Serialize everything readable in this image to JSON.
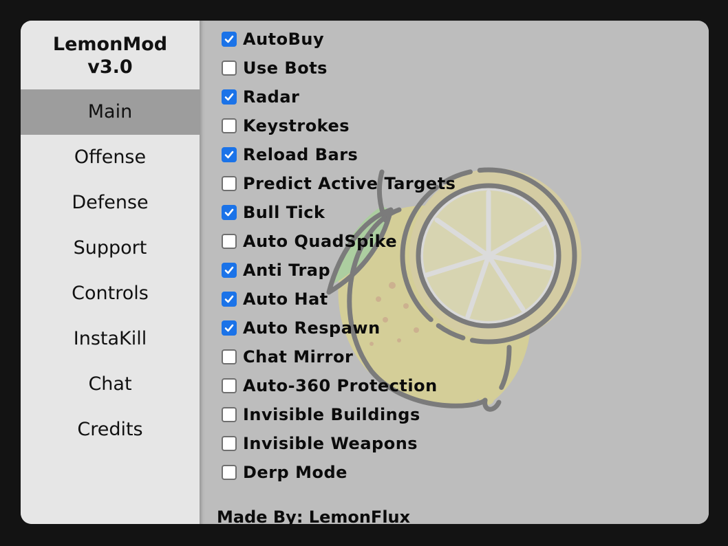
{
  "app": {
    "title": "LemonMod v3.0"
  },
  "sidebar": {
    "title_line1": "LemonMod",
    "title_line2": "v3.0",
    "active": "Main",
    "items": [
      {
        "label": "Main"
      },
      {
        "label": "Offense"
      },
      {
        "label": "Defense"
      },
      {
        "label": "Support"
      },
      {
        "label": "Controls"
      },
      {
        "label": "InstaKill"
      },
      {
        "label": "Chat"
      },
      {
        "label": "Credits"
      }
    ]
  },
  "main": {
    "options": [
      {
        "label": "AutoBuy",
        "checked": true
      },
      {
        "label": "Use Bots",
        "checked": false
      },
      {
        "label": "Radar",
        "checked": true
      },
      {
        "label": "Keystrokes",
        "checked": false
      },
      {
        "label": "Reload Bars",
        "checked": true
      },
      {
        "label": "Predict Active Targets",
        "checked": false
      },
      {
        "label": "Bull Tick",
        "checked": true
      },
      {
        "label": "Auto QuadSpike",
        "checked": false
      },
      {
        "label": "Anti Trap",
        "checked": true
      },
      {
        "label": "Auto Hat",
        "checked": true
      },
      {
        "label": "Auto Respawn",
        "checked": true
      },
      {
        "label": "Chat Mirror",
        "checked": false
      },
      {
        "label": "Auto-360 Protection",
        "checked": false
      },
      {
        "label": "Invisible Buildings",
        "checked": false
      },
      {
        "label": "Invisible Weapons",
        "checked": false
      },
      {
        "label": "Derp Mode",
        "checked": false
      }
    ],
    "footer": "Made By: LemonFlux"
  },
  "colors": {
    "checkbox_checked": "#1b73e8",
    "sidebar_bg": "#e6e6e6",
    "sidebar_active_bg": "#9d9d9d",
    "content_bg": "#bdbdbd"
  },
  "icons": {
    "background_watermark": "lemon-icon",
    "checkmark": "checkmark-icon"
  }
}
